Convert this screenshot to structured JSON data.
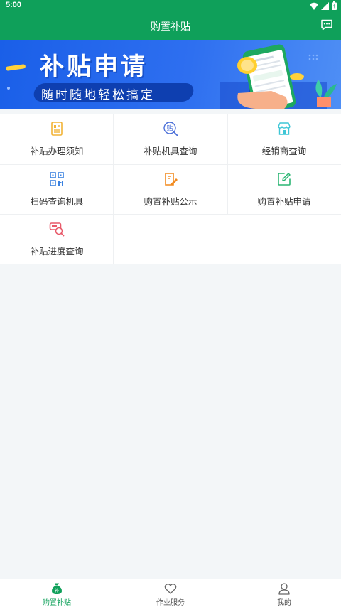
{
  "status_bar": {
    "time": "5:00"
  },
  "app_bar": {
    "title": "购置补贴",
    "icon": "chat-icon"
  },
  "banner": {
    "title": "补贴申请",
    "subtitle": "随时随地轻松搞定"
  },
  "grid": {
    "items": [
      {
        "label": "补贴办理须知",
        "icon": "document-icon",
        "color": "#f2b336"
      },
      {
        "label": "补贴机具查询",
        "icon": "subsidy-search-icon",
        "color": "#4b6fd8"
      },
      {
        "label": "经销商查询",
        "icon": "shop-icon",
        "color": "#3ec6d6"
      },
      {
        "label": "扫码查询机具",
        "icon": "qr-code-icon",
        "color": "#3b82e0"
      },
      {
        "label": "购置补贴公示",
        "icon": "notice-edit-icon",
        "color": "#f28a1f"
      },
      {
        "label": "购置补贴申请",
        "icon": "edit-icon",
        "color": "#2bb673"
      },
      {
        "label": "补贴进度查询",
        "icon": "progress-search-icon",
        "color": "#e85a6a"
      }
    ]
  },
  "bottom_nav": {
    "items": [
      {
        "label": "购置补贴",
        "icon": "money-bag-icon",
        "active": true
      },
      {
        "label": "作业服务",
        "icon": "heart-icon",
        "active": false
      },
      {
        "label": "我的",
        "icon": "user-icon",
        "active": false
      }
    ]
  },
  "colors": {
    "primary": "#0fa05a",
    "banner": "#2e6ff0"
  }
}
